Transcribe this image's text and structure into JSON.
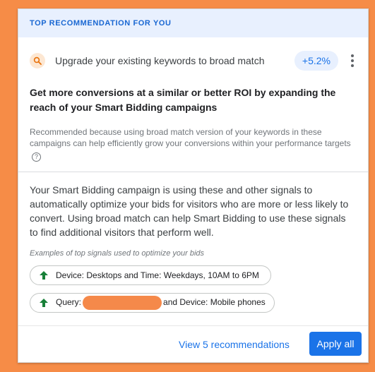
{
  "header": {
    "title": "TOP RECOMMENDATION FOR YOU"
  },
  "recommendation": {
    "icon": "search-icon",
    "title": "Upgrade your existing keywords to broad match",
    "uplift": "+5.2%",
    "menu_icon": "more-vert-icon"
  },
  "headline": "Get more conversions at a similar or better ROI by expanding the reach of your Smart Bidding campaigns",
  "reason": "Recommended because using broad match version of your keywords in these campaigns can help efficiently grow your conversions within your performance targets",
  "body": "Your Smart Bidding campaign is using these and other signals to automatically optimize your bids for visitors who are more or less likely to convert. Using broad match can help Smart Bidding to use these signals to find additional visitors that perform well.",
  "examples_label": "Examples of top signals used to optimize your bids",
  "signals": [
    {
      "text": "Device: Desktops and Time: Weekdays, 10AM to 6PM"
    },
    {
      "prefix": "Query:",
      "suffix": "and Device: Mobile phones"
    }
  ],
  "footer": {
    "view_label": "View 5 recommendations",
    "apply_label": "Apply all"
  },
  "colors": {
    "accent": "#1a73e8",
    "positive": "#188038",
    "background": "#f68c47",
    "redaction": "#f5894a"
  }
}
